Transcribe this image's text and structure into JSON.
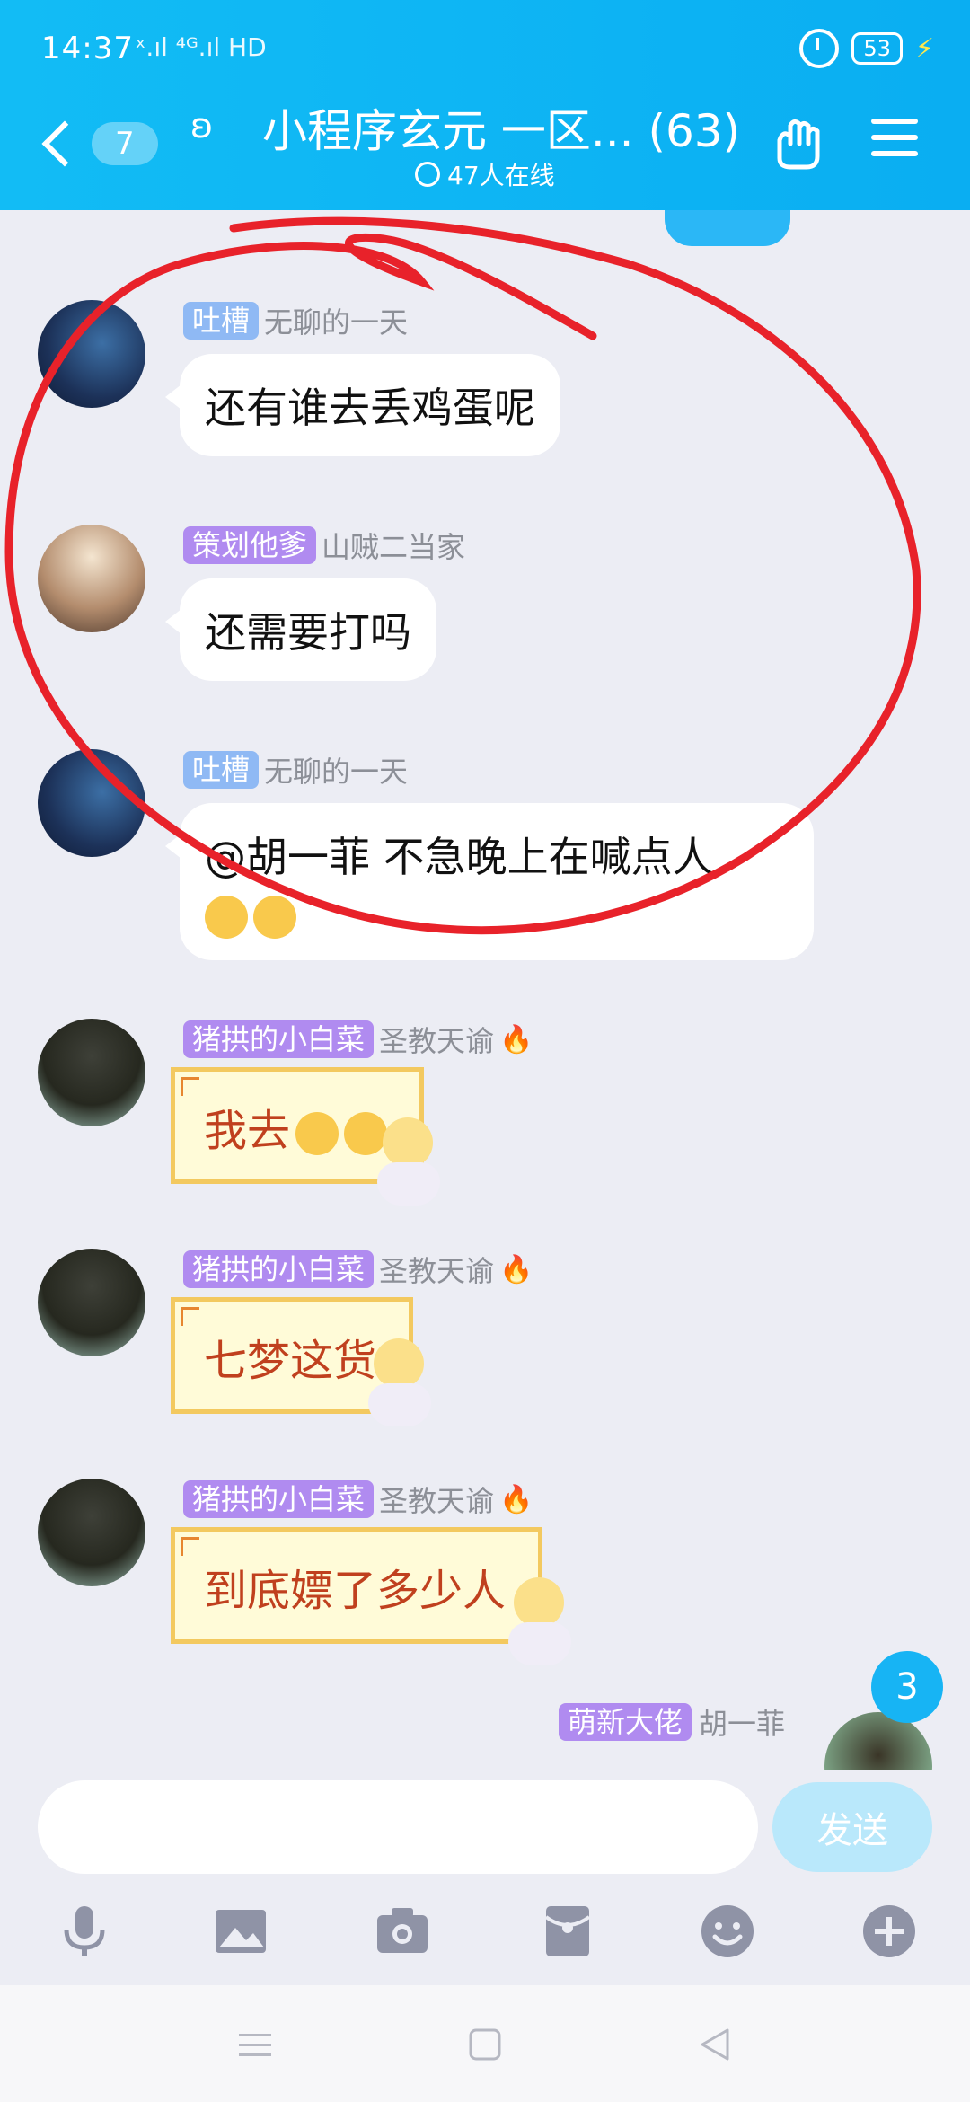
{
  "status": {
    "time": "14:37",
    "signal": "ˣ.ıl ⁴ᴳ.ıl HD",
    "battery": "53"
  },
  "header": {
    "unread_count": "7",
    "title": "小程序玄元 一区... (63)",
    "online": "47人在线"
  },
  "messages": [
    {
      "tag": "吐槽",
      "nick": "无聊的一天",
      "text": "还有谁去丢鸡蛋呢"
    },
    {
      "tag": "策划他爹",
      "nick": "山贼二当家",
      "text": "还需要打吗"
    },
    {
      "tag": "吐槽",
      "nick": "无聊的一天",
      "text": "@胡一菲 不急晚上在喊点人"
    },
    {
      "tag": "猪拱的小白菜",
      "nick": "圣教天谕",
      "text": "我去"
    },
    {
      "tag": "猪拱的小白菜",
      "nick": "圣教天谕",
      "text": "七梦这货"
    },
    {
      "tag": "猪拱的小白菜",
      "nick": "圣教天谕",
      "text": "到底嫖了多少人"
    }
  ],
  "self_message": {
    "tag": "萌新大佬",
    "nick": "胡一菲"
  },
  "floating_badge": "3",
  "input": {
    "value": "",
    "placeholder": "",
    "send_label": "发送"
  },
  "colors": {
    "header": "#0AAEF2",
    "annotation": "#E8222A",
    "card_text": "#C0401E"
  },
  "icons": [
    "mic-icon",
    "image-icon",
    "camera-icon",
    "red-packet-icon",
    "emoji-icon",
    "plus-icon"
  ]
}
